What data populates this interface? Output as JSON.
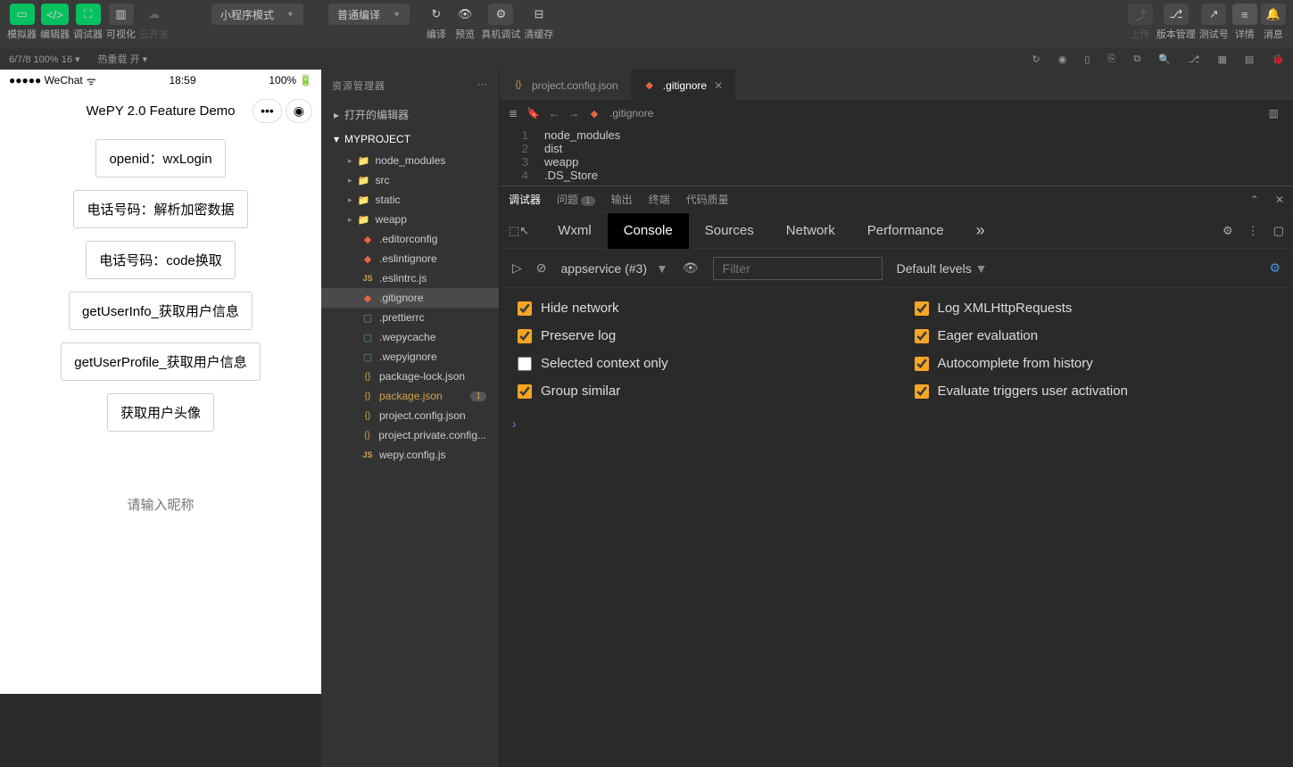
{
  "topbar": {
    "simulator": "模拟器",
    "editor": "编辑器",
    "debugger": "调试器",
    "visualize": "可视化",
    "cloud": "云开发",
    "mode": "小程序模式",
    "compile_mode": "普通编译",
    "compile": "编译",
    "preview": "预览",
    "real": "真机调试",
    "cache": "清缓存",
    "upload": "上传",
    "version": "版本管理",
    "test": "测试号",
    "detail": "详情",
    "message": "消息"
  },
  "infobar": {
    "left": "6/7/8 100% 16 ▾",
    "hot": "热重载 开 ▾"
  },
  "phone": {
    "carrier": "●●●●● WeChat",
    "wifi": "⌃",
    "time": "18:59",
    "batt": "100%",
    "title": "WePY 2.0 Feature Demo",
    "btns": {
      "openid": "openid：wxLogin",
      "phone1": "电话号码：解析加密数据",
      "phone2": "电话号码：code换取",
      "userinfo": "getUserInfo_获取用户信息",
      "userprofile": "getUserProfile_获取用户信息",
      "avatar": "获取用户头像"
    },
    "nick_ph": "请输入昵称"
  },
  "sidebar": {
    "title": "资源管理器",
    "open": "打开的编辑器",
    "proj": "MYPROJECT",
    "items": [
      {
        "k": "folder",
        "t": "node_modules"
      },
      {
        "k": "folder",
        "t": "src"
      },
      {
        "k": "folder",
        "t": "static"
      },
      {
        "k": "folder",
        "t": "weapp"
      },
      {
        "k": "git",
        "t": ".editorconfig"
      },
      {
        "k": "git",
        "t": ".eslintignore"
      },
      {
        "k": "js",
        "t": ".eslintrc.js"
      },
      {
        "k": "git",
        "t": ".gitignore",
        "sel": true
      },
      {
        "k": "file",
        "t": ".prettierrc"
      },
      {
        "k": "file",
        "t": ".wepycache"
      },
      {
        "k": "file",
        "t": ".wepyignore"
      },
      {
        "k": "json",
        "t": "package-lock.json"
      },
      {
        "k": "json",
        "t": "package.json",
        "mod": true,
        "badge": "1"
      },
      {
        "k": "json",
        "t": "project.config.json"
      },
      {
        "k": "json",
        "t": "project.private.config..."
      },
      {
        "k": "js",
        "t": "wepy.config.js"
      }
    ]
  },
  "editor": {
    "tabs": [
      {
        "t": "project.config.json",
        "ico": "json"
      },
      {
        "t": ".gitignore",
        "ico": "git",
        "active": true
      }
    ],
    "crumb": ".gitignore",
    "lines": [
      "node_modules",
      "dist",
      "weapp",
      ".DS_Store"
    ]
  },
  "panel": {
    "tabs": {
      "debugger": "调试器",
      "problems": "问题",
      "pcount": "1",
      "output": "输出",
      "terminal": "终端",
      "quality": "代码质量"
    },
    "devtabs": [
      "Wxml",
      "Console",
      "Sources",
      "Network",
      "Performance"
    ],
    "active_dt": "Console",
    "context": "appservice (#3)",
    "filter_ph": "Filter",
    "levels": "Default levels",
    "settings": [
      {
        "k": "hide",
        "l": "Hide network",
        "c": true
      },
      {
        "k": "logxhr",
        "l": "Log XMLHttpRequests",
        "c": true
      },
      {
        "k": "preserve",
        "l": "Preserve log",
        "c": true
      },
      {
        "k": "eager",
        "l": "Eager evaluation",
        "c": true
      },
      {
        "k": "selctx",
        "l": "Selected context only",
        "c": false
      },
      {
        "k": "autoc",
        "l": "Autocomplete from history",
        "c": true
      },
      {
        "k": "group",
        "l": "Group similar",
        "c": true
      },
      {
        "k": "evaltrig",
        "l": "Evaluate triggers user activation",
        "c": true
      }
    ]
  }
}
